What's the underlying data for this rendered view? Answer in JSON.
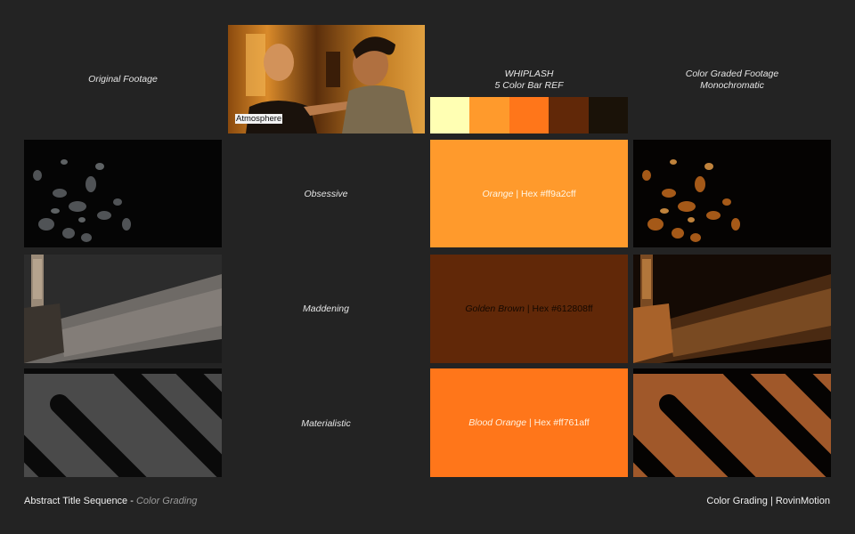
{
  "headers": {
    "original": "Original Footage",
    "ref_title": "WHIPLASH",
    "ref_subtitle": "5 Color Bar REF",
    "graded_title": "Color Graded Footage",
    "graded_subtitle": "Monochromatic"
  },
  "still": {
    "caption": "Atmosphere"
  },
  "color_bar": {
    "colors": [
      "#ffffb3",
      "#ff9a2c",
      "#ff761a",
      "#612808",
      "#1a1208"
    ]
  },
  "rows": [
    {
      "word": "Obsessive",
      "swatch_name": "Orange",
      "swatch_hex": " | Hex #ff9a2cff",
      "swatch_color": "#ff9a2c",
      "text_color": "#fff6e6"
    },
    {
      "word": "Maddening",
      "swatch_name": "Golden Brown",
      "swatch_hex": " | Hex #612808ff",
      "swatch_color": "#612808",
      "text_color": "#140800"
    },
    {
      "word": "Materialistic",
      "swatch_name": "Blood Orange",
      "swatch_hex": " | Hex #ff761aff",
      "swatch_color": "#ff761a",
      "text_color": "#fff2e0"
    }
  ],
  "footer": {
    "left_main": "Abstract Title Sequence - ",
    "left_sub": "Color Grading",
    "right": "Color Grading | RovinMotion"
  }
}
